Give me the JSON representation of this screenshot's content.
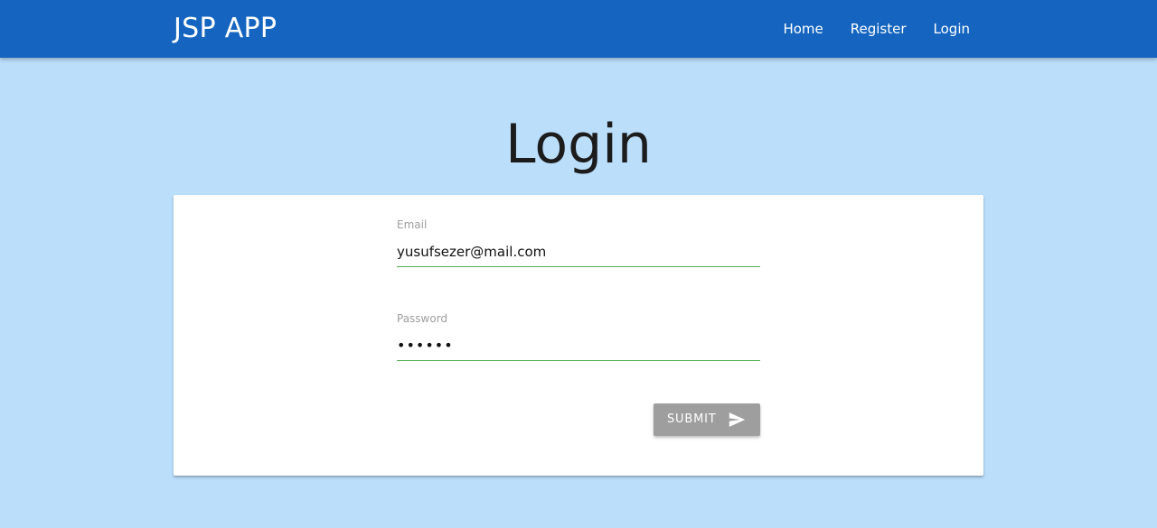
{
  "header": {
    "brand": "JSP APP",
    "nav": [
      {
        "label": "Home"
      },
      {
        "label": "Register"
      },
      {
        "label": "Login"
      }
    ]
  },
  "page": {
    "title": "Login"
  },
  "form": {
    "email": {
      "label": "Email",
      "value": "yusufsezer@mail.com"
    },
    "password": {
      "label": "Password",
      "value": "••••••"
    },
    "submit": {
      "label": "SUBMIT",
      "icon": "send-icon"
    }
  },
  "colors": {
    "navbar": "#1565c0",
    "background": "#bbdefb",
    "input_underline": "#4caf50",
    "submit_button": "#9e9e9e"
  }
}
